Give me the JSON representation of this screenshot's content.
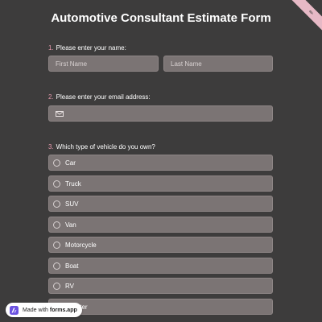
{
  "form": {
    "title": "Automotive Consultant Estimate Form",
    "accent_color": "#e7b9c6"
  },
  "questions": [
    {
      "number": "1.",
      "label": "Please enter your name:",
      "fields": [
        {
          "placeholder": "First Name"
        },
        {
          "placeholder": "Last Name"
        }
      ]
    },
    {
      "number": "2.",
      "label": "Please enter your email address:",
      "icon": "mail-icon"
    },
    {
      "number": "3.",
      "label": "Which type of vehicle do you own?",
      "options": [
        "Car",
        "Truck",
        "SUV",
        "Van",
        "Motorcycle",
        "Boat",
        "RV",
        "Scooter"
      ]
    }
  ],
  "badge": {
    "made_with": "Made with",
    "brand": "forms.app",
    "icon": "forms-app-logo-icon"
  }
}
